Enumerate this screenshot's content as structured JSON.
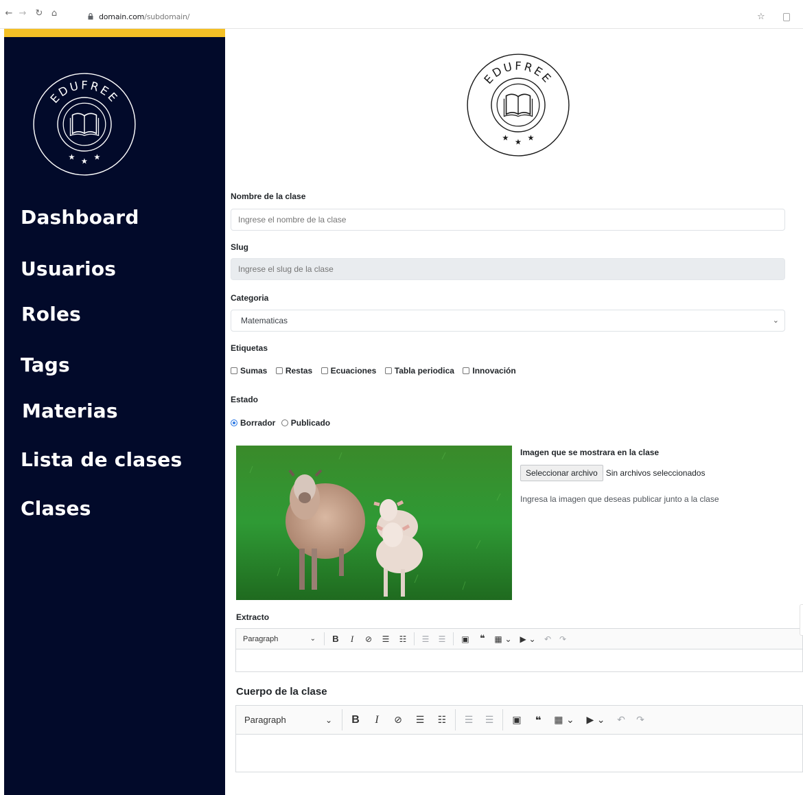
{
  "browser": {
    "url_host": "domain.com",
    "url_path": "/subdomain/"
  },
  "brand": {
    "name": "EDUFREE",
    "colors": {
      "sidebar_bg": "#020a2a",
      "accent": "#f4c026",
      "radio_selected": "#2f7be5"
    }
  },
  "sidebar": {
    "items": [
      {
        "label": "Dashboard"
      },
      {
        "label": "Usuarios"
      },
      {
        "label": "Roles"
      },
      {
        "label": "Tags"
      },
      {
        "label": "Materias"
      },
      {
        "label": "Lista de clases"
      },
      {
        "label": "Clases"
      }
    ]
  },
  "form": {
    "nombre": {
      "label": "Nombre de la clase",
      "placeholder": "Ingrese el nombre de la clase",
      "value": ""
    },
    "slug": {
      "label": "Slug",
      "placeholder": "Ingrese el slug de la clase",
      "value": ""
    },
    "categoria": {
      "label": "Categoria",
      "selected": "Matematicas"
    },
    "etiquetas": {
      "label": "Etiquetas",
      "options": [
        {
          "label": "Sumas",
          "checked": false
        },
        {
          "label": "Restas",
          "checked": false
        },
        {
          "label": "Ecuaciones",
          "checked": false
        },
        {
          "label": "Tabla periodica",
          "checked": false
        },
        {
          "label": "Innovación",
          "checked": false
        }
      ]
    },
    "estado": {
      "label": "Estado",
      "options": [
        {
          "label": "Borrador",
          "checked": true
        },
        {
          "label": "Publicado",
          "checked": false
        }
      ]
    },
    "imagen": {
      "label": "Imagen que se mostrara en la clase",
      "button": "Seleccionar archivo",
      "status": "Sin archivos seleccionados",
      "help": "Ingresa la imagen que deseas publicar junto a la clase"
    },
    "extracto": {
      "label": "Extracto",
      "format": "Paragraph"
    },
    "cuerpo": {
      "label": "Cuerpo de la clase",
      "format": "Paragraph"
    }
  }
}
